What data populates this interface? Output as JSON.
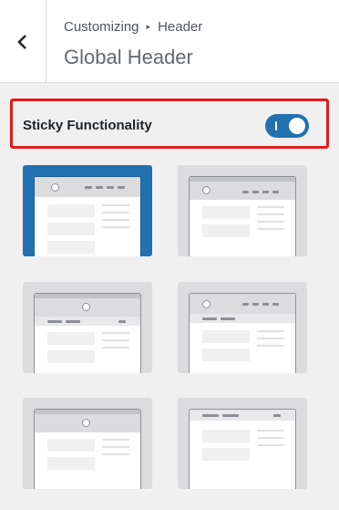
{
  "header": {
    "back_icon": "chevron-left-icon",
    "breadcrumb": {
      "parent": "Customizing",
      "separator": "▸",
      "current": "Header"
    },
    "title": "Global Header"
  },
  "sticky": {
    "label": "Sticky Functionality",
    "enabled": true,
    "toggle_color": "#2271b1"
  },
  "layouts": {
    "selected_index": 0,
    "items": [
      "layout-1",
      "layout-2",
      "layout-3",
      "layout-4",
      "layout-5",
      "layout-6"
    ]
  },
  "colors": {
    "accent": "#2271b1",
    "highlight_border": "#e11d1d"
  }
}
